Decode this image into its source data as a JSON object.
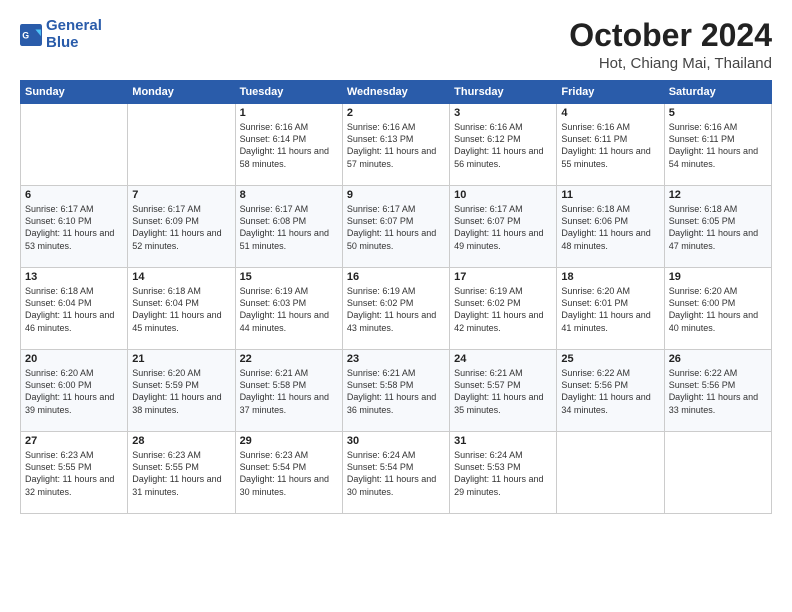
{
  "header": {
    "logo_line1": "General",
    "logo_line2": "Blue",
    "month_title": "October 2024",
    "location": "Hot, Chiang Mai, Thailand"
  },
  "weekdays": [
    "Sunday",
    "Monday",
    "Tuesday",
    "Wednesday",
    "Thursday",
    "Friday",
    "Saturday"
  ],
  "weeks": [
    [
      {
        "day": "",
        "info": ""
      },
      {
        "day": "",
        "info": ""
      },
      {
        "day": "1",
        "info": "Sunrise: 6:16 AM\nSunset: 6:14 PM\nDaylight: 11 hours and 58 minutes."
      },
      {
        "day": "2",
        "info": "Sunrise: 6:16 AM\nSunset: 6:13 PM\nDaylight: 11 hours and 57 minutes."
      },
      {
        "day": "3",
        "info": "Sunrise: 6:16 AM\nSunset: 6:12 PM\nDaylight: 11 hours and 56 minutes."
      },
      {
        "day": "4",
        "info": "Sunrise: 6:16 AM\nSunset: 6:11 PM\nDaylight: 11 hours and 55 minutes."
      },
      {
        "day": "5",
        "info": "Sunrise: 6:16 AM\nSunset: 6:11 PM\nDaylight: 11 hours and 54 minutes."
      }
    ],
    [
      {
        "day": "6",
        "info": "Sunrise: 6:17 AM\nSunset: 6:10 PM\nDaylight: 11 hours and 53 minutes."
      },
      {
        "day": "7",
        "info": "Sunrise: 6:17 AM\nSunset: 6:09 PM\nDaylight: 11 hours and 52 minutes."
      },
      {
        "day": "8",
        "info": "Sunrise: 6:17 AM\nSunset: 6:08 PM\nDaylight: 11 hours and 51 minutes."
      },
      {
        "day": "9",
        "info": "Sunrise: 6:17 AM\nSunset: 6:07 PM\nDaylight: 11 hours and 50 minutes."
      },
      {
        "day": "10",
        "info": "Sunrise: 6:17 AM\nSunset: 6:07 PM\nDaylight: 11 hours and 49 minutes."
      },
      {
        "day": "11",
        "info": "Sunrise: 6:18 AM\nSunset: 6:06 PM\nDaylight: 11 hours and 48 minutes."
      },
      {
        "day": "12",
        "info": "Sunrise: 6:18 AM\nSunset: 6:05 PM\nDaylight: 11 hours and 47 minutes."
      }
    ],
    [
      {
        "day": "13",
        "info": "Sunrise: 6:18 AM\nSunset: 6:04 PM\nDaylight: 11 hours and 46 minutes."
      },
      {
        "day": "14",
        "info": "Sunrise: 6:18 AM\nSunset: 6:04 PM\nDaylight: 11 hours and 45 minutes."
      },
      {
        "day": "15",
        "info": "Sunrise: 6:19 AM\nSunset: 6:03 PM\nDaylight: 11 hours and 44 minutes."
      },
      {
        "day": "16",
        "info": "Sunrise: 6:19 AM\nSunset: 6:02 PM\nDaylight: 11 hours and 43 minutes."
      },
      {
        "day": "17",
        "info": "Sunrise: 6:19 AM\nSunset: 6:02 PM\nDaylight: 11 hours and 42 minutes."
      },
      {
        "day": "18",
        "info": "Sunrise: 6:20 AM\nSunset: 6:01 PM\nDaylight: 11 hours and 41 minutes."
      },
      {
        "day": "19",
        "info": "Sunrise: 6:20 AM\nSunset: 6:00 PM\nDaylight: 11 hours and 40 minutes."
      }
    ],
    [
      {
        "day": "20",
        "info": "Sunrise: 6:20 AM\nSunset: 6:00 PM\nDaylight: 11 hours and 39 minutes."
      },
      {
        "day": "21",
        "info": "Sunrise: 6:20 AM\nSunset: 5:59 PM\nDaylight: 11 hours and 38 minutes."
      },
      {
        "day": "22",
        "info": "Sunrise: 6:21 AM\nSunset: 5:58 PM\nDaylight: 11 hours and 37 minutes."
      },
      {
        "day": "23",
        "info": "Sunrise: 6:21 AM\nSunset: 5:58 PM\nDaylight: 11 hours and 36 minutes."
      },
      {
        "day": "24",
        "info": "Sunrise: 6:21 AM\nSunset: 5:57 PM\nDaylight: 11 hours and 35 minutes."
      },
      {
        "day": "25",
        "info": "Sunrise: 6:22 AM\nSunset: 5:56 PM\nDaylight: 11 hours and 34 minutes."
      },
      {
        "day": "26",
        "info": "Sunrise: 6:22 AM\nSunset: 5:56 PM\nDaylight: 11 hours and 33 minutes."
      }
    ],
    [
      {
        "day": "27",
        "info": "Sunrise: 6:23 AM\nSunset: 5:55 PM\nDaylight: 11 hours and 32 minutes."
      },
      {
        "day": "28",
        "info": "Sunrise: 6:23 AM\nSunset: 5:55 PM\nDaylight: 11 hours and 31 minutes."
      },
      {
        "day": "29",
        "info": "Sunrise: 6:23 AM\nSunset: 5:54 PM\nDaylight: 11 hours and 30 minutes."
      },
      {
        "day": "30",
        "info": "Sunrise: 6:24 AM\nSunset: 5:54 PM\nDaylight: 11 hours and 30 minutes."
      },
      {
        "day": "31",
        "info": "Sunrise: 6:24 AM\nSunset: 5:53 PM\nDaylight: 11 hours and 29 minutes."
      },
      {
        "day": "",
        "info": ""
      },
      {
        "day": "",
        "info": ""
      }
    ]
  ]
}
